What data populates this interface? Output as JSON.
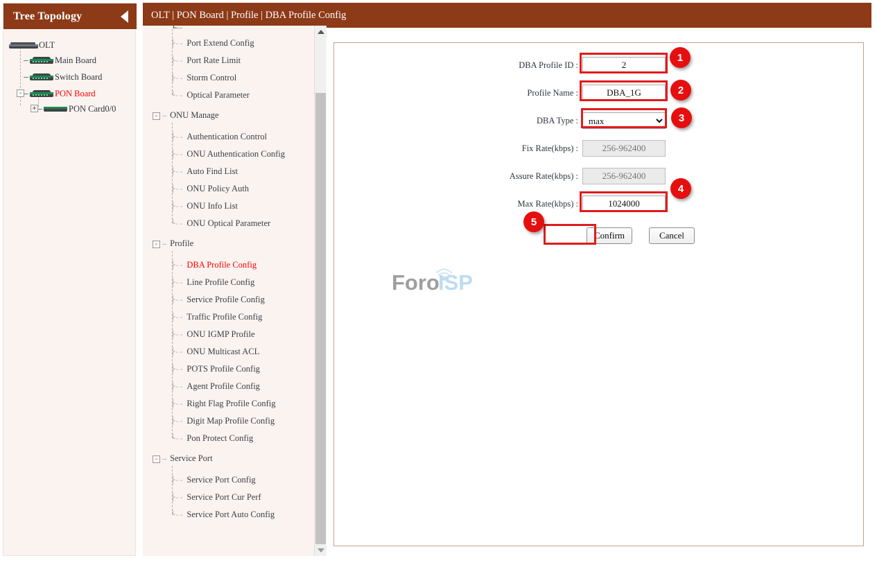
{
  "tree": {
    "header_title": "Tree Topology",
    "collapse_icon": "triangle-left-icon",
    "nodes": [
      {
        "label": "OLT",
        "icon": "olt-icon",
        "depth": 0,
        "expander": "",
        "selected": false
      },
      {
        "label": "Main Board",
        "icon": "board-icon",
        "depth": 1,
        "expander": "",
        "selected": false
      },
      {
        "label": "Switch Board",
        "icon": "board-icon",
        "depth": 1,
        "expander": "",
        "selected": false
      },
      {
        "label": "PON Board",
        "icon": "board-icon",
        "depth": 1,
        "expander": "-",
        "selected": true
      },
      {
        "label": "PON Card0/0",
        "icon": "board-plain-icon",
        "depth": 2,
        "expander": "+",
        "selected": false
      }
    ]
  },
  "topbar": {
    "breadcrumb": "OLT | PON Board | Profile | DBA Profile Config"
  },
  "menu": {
    "items": [
      {
        "label": "Port Extend Config",
        "type": "leaf",
        "active": false
      },
      {
        "label": "Port Rate Limit",
        "type": "leaf",
        "active": false
      },
      {
        "label": "Storm Control",
        "type": "leaf",
        "active": false
      },
      {
        "label": "Optical Parameter",
        "type": "leaf-last",
        "active": false
      },
      {
        "label": "ONU Manage",
        "type": "group",
        "active": false
      },
      {
        "label": "Authentication Control",
        "type": "leaf",
        "active": false
      },
      {
        "label": "ONU Authentication Config",
        "type": "leaf",
        "active": false
      },
      {
        "label": "Auto Find List",
        "type": "leaf",
        "active": false
      },
      {
        "label": "ONU Policy Auth",
        "type": "leaf",
        "active": false
      },
      {
        "label": "ONU Info List",
        "type": "leaf",
        "active": false
      },
      {
        "label": "ONU Optical Parameter",
        "type": "leaf-last",
        "active": false
      },
      {
        "label": "Profile",
        "type": "group",
        "active": false
      },
      {
        "label": "DBA Profile Config",
        "type": "leaf",
        "active": true
      },
      {
        "label": "Line Profile Config",
        "type": "leaf",
        "active": false
      },
      {
        "label": "Service Profile Config",
        "type": "leaf",
        "active": false
      },
      {
        "label": "Traffic Profile Config",
        "type": "leaf",
        "active": false
      },
      {
        "label": "ONU IGMP Profile",
        "type": "leaf",
        "active": false
      },
      {
        "label": "ONU Multicast ACL",
        "type": "leaf",
        "active": false
      },
      {
        "label": "POTS Profile Config",
        "type": "leaf",
        "active": false
      },
      {
        "label": "Agent Profile Config",
        "type": "leaf",
        "active": false
      },
      {
        "label": "Right Flag Profile Config",
        "type": "leaf",
        "active": false
      },
      {
        "label": "Digit Map Profile Config",
        "type": "leaf",
        "active": false
      },
      {
        "label": "Pon Protect Config",
        "type": "leaf-last",
        "active": false
      },
      {
        "label": "Service Port",
        "type": "group",
        "active": false
      },
      {
        "label": "Service Port Config",
        "type": "leaf",
        "active": false
      },
      {
        "label": "Service Port Cur Perf",
        "type": "leaf",
        "active": false
      },
      {
        "label": "Service Port Auto Config",
        "type": "leaf-last",
        "active": false
      }
    ],
    "group_collapse_glyph": "-",
    "scrollbar": {
      "up_icon": "scroll-up-icon",
      "down_icon": "scroll-down-icon"
    }
  },
  "form": {
    "fields": [
      {
        "label": "DBA Profile ID :",
        "value": "2",
        "placeholder": "",
        "kind": "text",
        "disabled": false,
        "highlighted": true
      },
      {
        "label": "Profile Name :",
        "value": "DBA_1G",
        "placeholder": "",
        "kind": "text",
        "disabled": false,
        "highlighted": true
      },
      {
        "label": "DBA Type :",
        "value": "max",
        "placeholder": "",
        "kind": "select",
        "disabled": false,
        "highlighted": true,
        "options": [
          "max"
        ]
      },
      {
        "label": "Fix Rate(kbps) :",
        "value": "",
        "placeholder": "256-962400",
        "kind": "text",
        "disabled": true,
        "highlighted": false
      },
      {
        "label": "Assure Rate(kbps) :",
        "value": "",
        "placeholder": "256-962400",
        "kind": "text",
        "disabled": true,
        "highlighted": false
      },
      {
        "label": "Max Rate(kbps) :",
        "value": "1024000",
        "placeholder": "",
        "kind": "text",
        "disabled": false,
        "highlighted": true
      }
    ],
    "confirm_label": "Confirm",
    "cancel_label": "Cancel",
    "dropdown_icon": "chevron-down-icon"
  },
  "annotations": {
    "badges": [
      "1",
      "2",
      "3",
      "4",
      "5"
    ]
  },
  "watermark": {
    "text_primary": "Foro",
    "text_secondary": "ISP",
    "icon": "wifi-signal-icon"
  },
  "colors": {
    "header_brown": "#8c3a17",
    "panel_bg": "#faf3f0",
    "accent_red": "#ff0000",
    "badge_red": "#e60f0f",
    "highlight_red": "#e01b1b",
    "content_border": "#c79e8c",
    "watermark_gray": "#9e9e9e",
    "watermark_blue": "#bcdcf2"
  }
}
